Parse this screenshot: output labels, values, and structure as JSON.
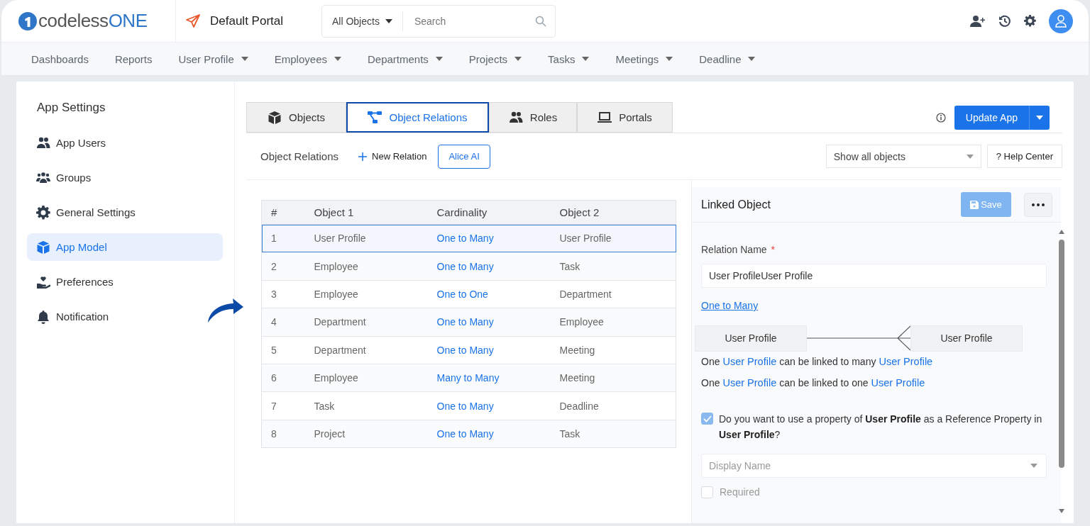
{
  "header": {
    "logo": [
      "codeless",
      "ONE"
    ],
    "portal": "Default Portal",
    "search": {
      "scope": "All Objects",
      "placeholder": "Search"
    }
  },
  "nav": [
    {
      "label": "Dashboards",
      "dropdown": false
    },
    {
      "label": "Reports",
      "dropdown": false
    },
    {
      "label": "User Profile",
      "dropdown": true
    },
    {
      "label": "Employees",
      "dropdown": true
    },
    {
      "label": "Departments",
      "dropdown": true
    },
    {
      "label": "Projects",
      "dropdown": true
    },
    {
      "label": "Tasks",
      "dropdown": true
    },
    {
      "label": "Meetings",
      "dropdown": true
    },
    {
      "label": "Deadline",
      "dropdown": true
    }
  ],
  "sidebar": {
    "title": "App Settings",
    "items": [
      {
        "label": "App Users",
        "kind": "users",
        "selected": false
      },
      {
        "label": "Groups",
        "kind": "groups",
        "selected": false
      },
      {
        "label": "General Settings",
        "kind": "gear",
        "selected": false
      },
      {
        "label": "App Model",
        "kind": "cube",
        "selected": true
      },
      {
        "label": "Preferences",
        "kind": "hand",
        "selected": false
      },
      {
        "label": "Notification",
        "kind": "bell",
        "selected": false
      }
    ]
  },
  "tabs": [
    {
      "label": "Objects",
      "kind": "cube",
      "selected": false
    },
    {
      "label": "Object Relations",
      "kind": "relations",
      "selected": true
    },
    {
      "label": "Roles",
      "kind": "users",
      "selected": false
    },
    {
      "label": "Portals",
      "kind": "laptop",
      "selected": false
    }
  ],
  "update_button": "Update App",
  "toolbar": {
    "title": "Object Relations",
    "new_relation": "New Relation",
    "ai_button": "Alice AI",
    "filter": "Show all objects",
    "help": "? Help Center"
  },
  "table": {
    "columns": [
      "#",
      "Object 1",
      "Cardinality",
      "Object 2"
    ],
    "rows": [
      {
        "cells": [
          "1",
          "User Profile",
          "One to Many",
          "User Profile"
        ],
        "selected": true
      },
      {
        "cells": [
          "2",
          "Employee",
          "One to Many",
          "Task"
        ],
        "selected": false
      },
      {
        "cells": [
          "3",
          "Employee",
          "One to One",
          "Department"
        ],
        "selected": false
      },
      {
        "cells": [
          "4",
          "Department",
          "One to Many",
          "Employee"
        ],
        "selected": false
      },
      {
        "cells": [
          "5",
          "Department",
          "One to Many",
          "Meeting"
        ],
        "selected": false
      },
      {
        "cells": [
          "6",
          "Employee",
          "Many to Many",
          "Meeting"
        ],
        "selected": false
      },
      {
        "cells": [
          "7",
          "Task",
          "One to Many",
          "Deadline"
        ],
        "selected": false
      },
      {
        "cells": [
          "8",
          "Project",
          "One to Many",
          "Task"
        ],
        "selected": false
      }
    ]
  },
  "panel": {
    "title": "Linked Object",
    "save": "Save",
    "relation_label": "Relation Name",
    "required_mark": "*",
    "relation_value": "User ProfileUser Profile",
    "cardinality": "One to Many",
    "diagram": {
      "left": "User Profile",
      "right": "User Profile"
    },
    "sentences": [
      [
        {
          "text": "One",
          "kind": "plain"
        },
        {
          "text": "User Profile",
          "kind": "link"
        },
        {
          "text": "can be linked to many",
          "kind": "plain"
        },
        {
          "text": "User Profile",
          "kind": "link"
        }
      ],
      [
        {
          "text": "One",
          "kind": "plain"
        },
        {
          "text": "User Profile",
          "kind": "link"
        },
        {
          "text": "can be linked to one",
          "kind": "plain"
        },
        {
          "text": "User Profile",
          "kind": "link"
        }
      ]
    ],
    "reference": {
      "checked": true,
      "text": "Do you want to use a property of **User Profile** as a Reference Property in **User Profile**?"
    },
    "display_select": {
      "placeholder": "Display Name"
    },
    "required_option": {
      "label": "Required",
      "checked": false
    }
  }
}
